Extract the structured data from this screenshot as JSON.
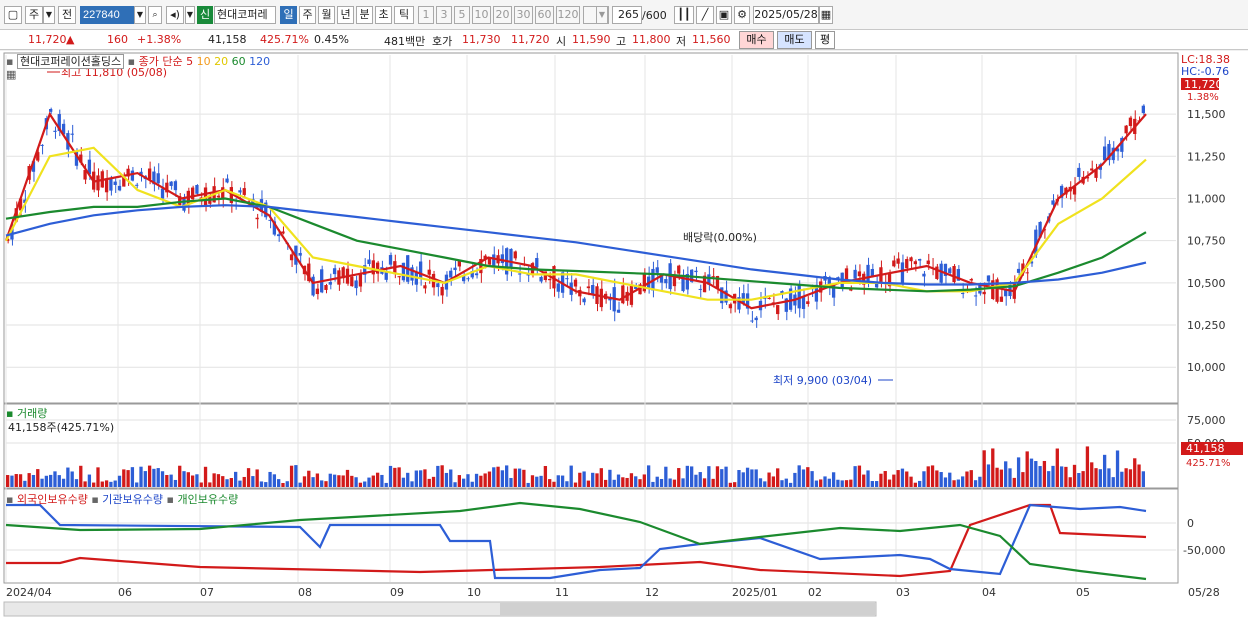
{
  "toolbar": {
    "period": "주",
    "prev_label": "전",
    "code": "227840",
    "new_badge": "신",
    "name": "현대코퍼레",
    "period_tabs": [
      "일",
      "주",
      "월",
      "년",
      "분",
      "초",
      "틱"
    ],
    "active_tab": "일",
    "number_tabs": [
      "1",
      "3",
      "5",
      "10",
      "20",
      "30",
      "60",
      "120"
    ],
    "count": "265",
    "count_total": "/600",
    "date": "2025/05/28"
  },
  "quote": {
    "price": "11,720",
    "change": "160",
    "change_pct": "+1.38%",
    "volume": "41,158",
    "volume_pct": "425.71%",
    "turnover": "0.45%",
    "amount": "481백만",
    "ask_label": "호가",
    "ask": "11,730",
    "bid": "11,720",
    "open_label": "시",
    "open": "11,590",
    "high_label": "고",
    "high": "11,800",
    "low_label": "저",
    "low": "11,560",
    "buy_label": "매수",
    "sell_label": "매도",
    "flat_label": "평"
  },
  "legend": {
    "name": "현대코퍼레이션홀딩스",
    "ma_label": "종가 단순",
    "periods": [
      "5",
      "10",
      "20",
      "60",
      "120"
    ],
    "colors": [
      "#d21a1a",
      "#f29a1d",
      "#f0e21e",
      "#1b8a2e",
      "#2d5ed6"
    ],
    "high_note": "최고 11,810 (05/08)",
    "low_note": "최저 9,900 (03/04)",
    "dividend_note": "배당락(0.00%)",
    "lc": "LC:18.38",
    "hc": "HC:-0.76",
    "price_tag": "11,720",
    "pct_tag": "1.38%"
  },
  "volume_panel": {
    "title": "거래량",
    "current": "41,158주(425.71%)",
    "tag": "41,158",
    "tag_pct": "425.71%"
  },
  "holdings_panel": {
    "series": [
      "외국인보유수량",
      "기관보유수량",
      "개인보유수량"
    ]
  },
  "axis": {
    "price_ticks": [
      "11,500",
      "11,250",
      "11,000",
      "10,750",
      "10,500",
      "10,250",
      "10,000"
    ],
    "volume_ticks": [
      "75,000",
      "50,000"
    ],
    "holding_ticks": [
      "0",
      "-50,000"
    ],
    "x_ticks": [
      "2024/04",
      "06",
      "07",
      "08",
      "09",
      "10",
      "11",
      "12",
      "2025/01",
      "02",
      "03",
      "04",
      "05",
      "05/28"
    ]
  },
  "chart_data": {
    "type": "line",
    "series": [
      {
        "name": "5",
        "values": [
          10750,
          11500,
          11100,
          11150,
          11000,
          11050,
          10900,
          10500,
          10550,
          10600,
          10500,
          10650,
          10600,
          10450,
          10400,
          10550,
          10500,
          10350,
          10400,
          10500,
          10550,
          10600,
          10500,
          10450,
          11000,
          11200,
          11500
        ]
      },
      {
        "name": "20",
        "values": [
          10750,
          11250,
          11300,
          11050,
          10950,
          11050,
          10950,
          10650,
          10600,
          10550,
          10500,
          10600,
          10550,
          10550,
          10500,
          10450,
          10400,
          10400,
          10450,
          10500,
          10500,
          10450,
          10450,
          10500,
          10850,
          11000,
          11230
        ]
      },
      {
        "name": "60",
        "values": [
          10880,
          10920,
          10950,
          10950,
          10980,
          11000,
          10950,
          10850,
          10750,
          10700,
          10650,
          10600,
          10580,
          10570,
          10560,
          10550,
          10530,
          10510,
          10490,
          10470,
          10460,
          10450,
          10460,
          10480,
          10560,
          10650,
          10800
        ]
      },
      {
        "name": "120",
        "values": [
          10780,
          10850,
          10900,
          10930,
          10950,
          10960,
          10950,
          10920,
          10890,
          10860,
          10830,
          10800,
          10770,
          10740,
          10700,
          10660,
          10620,
          10580,
          10550,
          10520,
          10500,
          10490,
          10490,
          10500,
          10520,
          10560,
          10620
        ]
      }
    ],
    "ylim": [
      9800,
      11850
    ]
  }
}
